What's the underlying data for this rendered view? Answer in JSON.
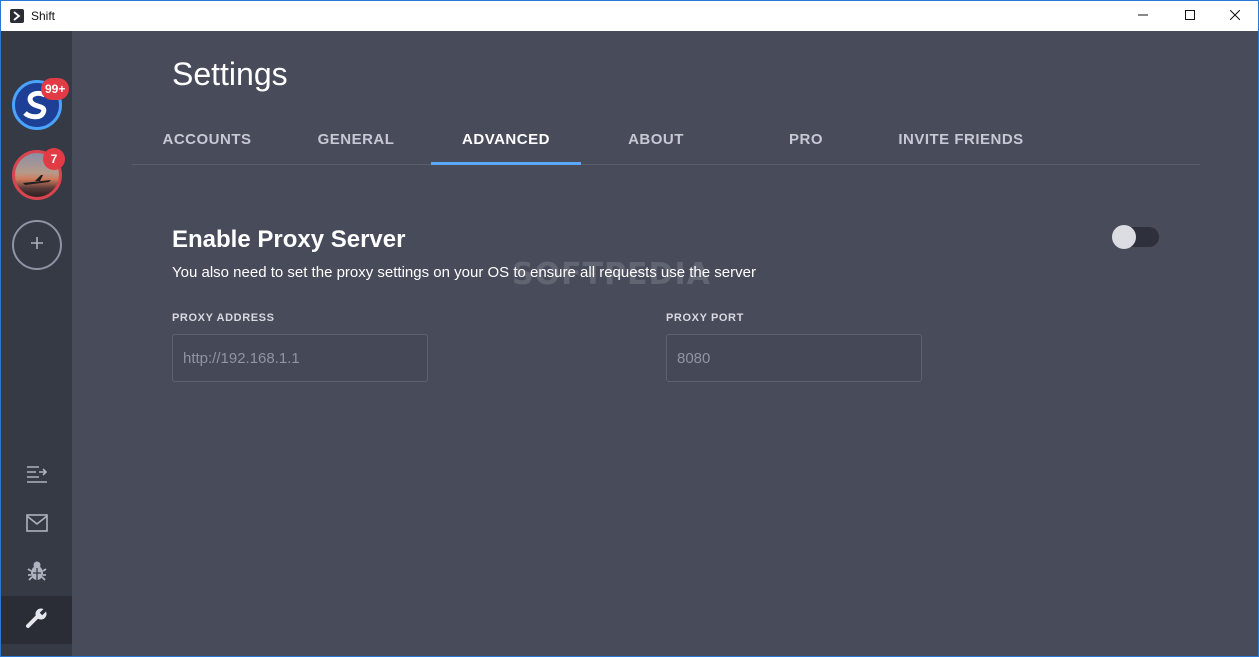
{
  "window": {
    "title": "Shift",
    "controls": {
      "minimize": "minimize-icon",
      "maximize": "maximize-icon",
      "close": "close-icon"
    }
  },
  "sidebar": {
    "accounts": [
      {
        "badge": "99+",
        "ring_color": "#4aa3ff"
      },
      {
        "badge": "7",
        "ring_color": "#d9454e"
      }
    ],
    "add_icon": "plus-icon",
    "tools": [
      {
        "icon": "list-arrow-icon"
      },
      {
        "icon": "mail-icon"
      },
      {
        "icon": "bug-icon"
      },
      {
        "icon": "wrench-icon",
        "active": true
      }
    ]
  },
  "main": {
    "title": "Settings",
    "tabs": [
      {
        "label": "ACCOUNTS",
        "active": false
      },
      {
        "label": "GENERAL",
        "active": false
      },
      {
        "label": "ADVANCED",
        "active": true
      },
      {
        "label": "ABOUT",
        "active": false
      },
      {
        "label": "PRO",
        "active": false
      },
      {
        "label": "INVITE FRIENDS",
        "active": false
      }
    ],
    "proxy": {
      "title": "Enable Proxy Server",
      "description": "You also need to set the proxy settings on your OS to ensure all requests use the server",
      "enabled": false,
      "address_label": "PROXY ADDRESS",
      "address_placeholder": "http://192.168.1.1",
      "address_value": "",
      "port_label": "PROXY PORT",
      "port_placeholder": "8080",
      "port_value": ""
    },
    "watermark": "SOFTPEDIA"
  },
  "colors": {
    "background": "#474b5a",
    "sidebar": "#363a45",
    "accent": "#5ba7ff",
    "badge": "#e23b45"
  }
}
